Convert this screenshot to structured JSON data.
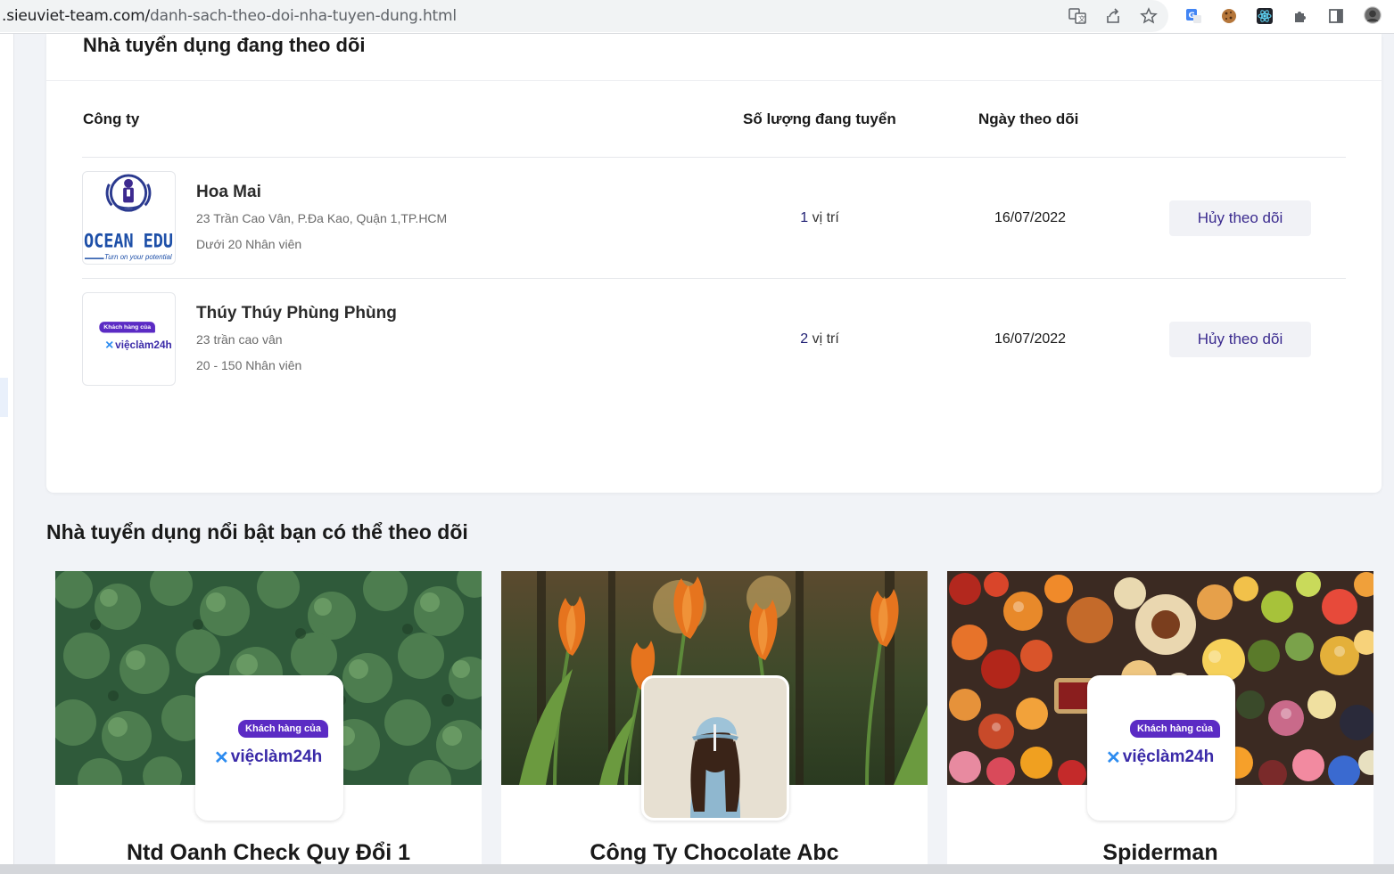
{
  "browser": {
    "url_domain": ".sieuviet-team.com/",
    "url_path": "danh-sach-theo-doi-nha-tuyen-dung.html"
  },
  "followed": {
    "title": "Nhà tuyển dụng đang theo dõi",
    "columns": {
      "company": "Công ty",
      "count": "Số lượng đang tuyển",
      "date": "Ngày theo dõi"
    },
    "rows": [
      {
        "name": "Hoa Mai",
        "address": "23 Trần Cao Vân, P.Đa Kao, Quận 1,TP.HCM",
        "size": "Dưới 20 Nhân viên",
        "count_num": "1",
        "count_unit": "vị trí",
        "date": "16/07/2022",
        "action": "Hủy theo dõi",
        "logo_text": "OCEAN EDU",
        "logo_tagline": "Turn on your potential"
      },
      {
        "name": "Thúy Thúy Phùng Phùng",
        "address": "23 trần cao vân",
        "size": "20 - 150 Nhân viên",
        "count_num": "2",
        "count_unit": "vị trí",
        "date": "16/07/2022",
        "action": "Hủy theo dõi",
        "logo_badge": "Khách hàng của",
        "logo_word": "việclàm24h"
      }
    ]
  },
  "suggested": {
    "title": "Nhà tuyển dụng nổi bật bạn có thể theo dõi",
    "cards": [
      {
        "name": "Ntd Oanh Check Quy Đổi 1",
        "logo_badge": "Khách hàng của",
        "logo_word": "việclàm24h"
      },
      {
        "name": "Công Ty Chocolate Abc"
      },
      {
        "name": "Spiderman",
        "logo_badge": "Khách hàng của",
        "logo_word": "việclàm24h"
      }
    ]
  },
  "colors": {
    "accent": "#3a2a8e",
    "count_text": "#1f1f73",
    "button_bg": "#f1f2f6"
  }
}
